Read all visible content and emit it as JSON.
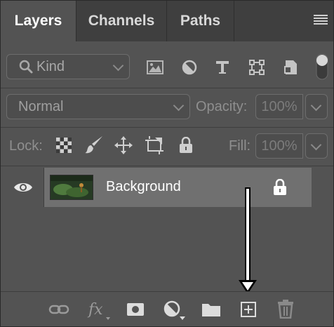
{
  "tabs": [
    {
      "label": "Layers",
      "active": true
    },
    {
      "label": "Channels",
      "active": false
    },
    {
      "label": "Paths",
      "active": false
    }
  ],
  "filter": {
    "kind_label": "Kind",
    "icons": [
      "image-filter-icon",
      "adjustment-filter-icon",
      "type-filter-icon",
      "shape-filter-icon",
      "smart-object-filter-icon",
      "filter-toggle"
    ]
  },
  "blend": {
    "mode": "Normal",
    "opacity_label": "Opacity:",
    "opacity_value": "100%"
  },
  "lock": {
    "label": "Lock:",
    "fill_label": "Fill:",
    "fill_value": "100%"
  },
  "layers": [
    {
      "name": "Background",
      "visible": true,
      "locked": true
    }
  ],
  "bottom_icons": [
    "link-layers-icon",
    "fx-icon",
    "add-mask-icon",
    "adjustment-layer-icon",
    "new-group-icon",
    "new-layer-icon",
    "delete-layer-icon"
  ],
  "colors": {
    "panel": "#535353",
    "tabbar": "#3f3f3f",
    "selected_layer": "#707070"
  }
}
